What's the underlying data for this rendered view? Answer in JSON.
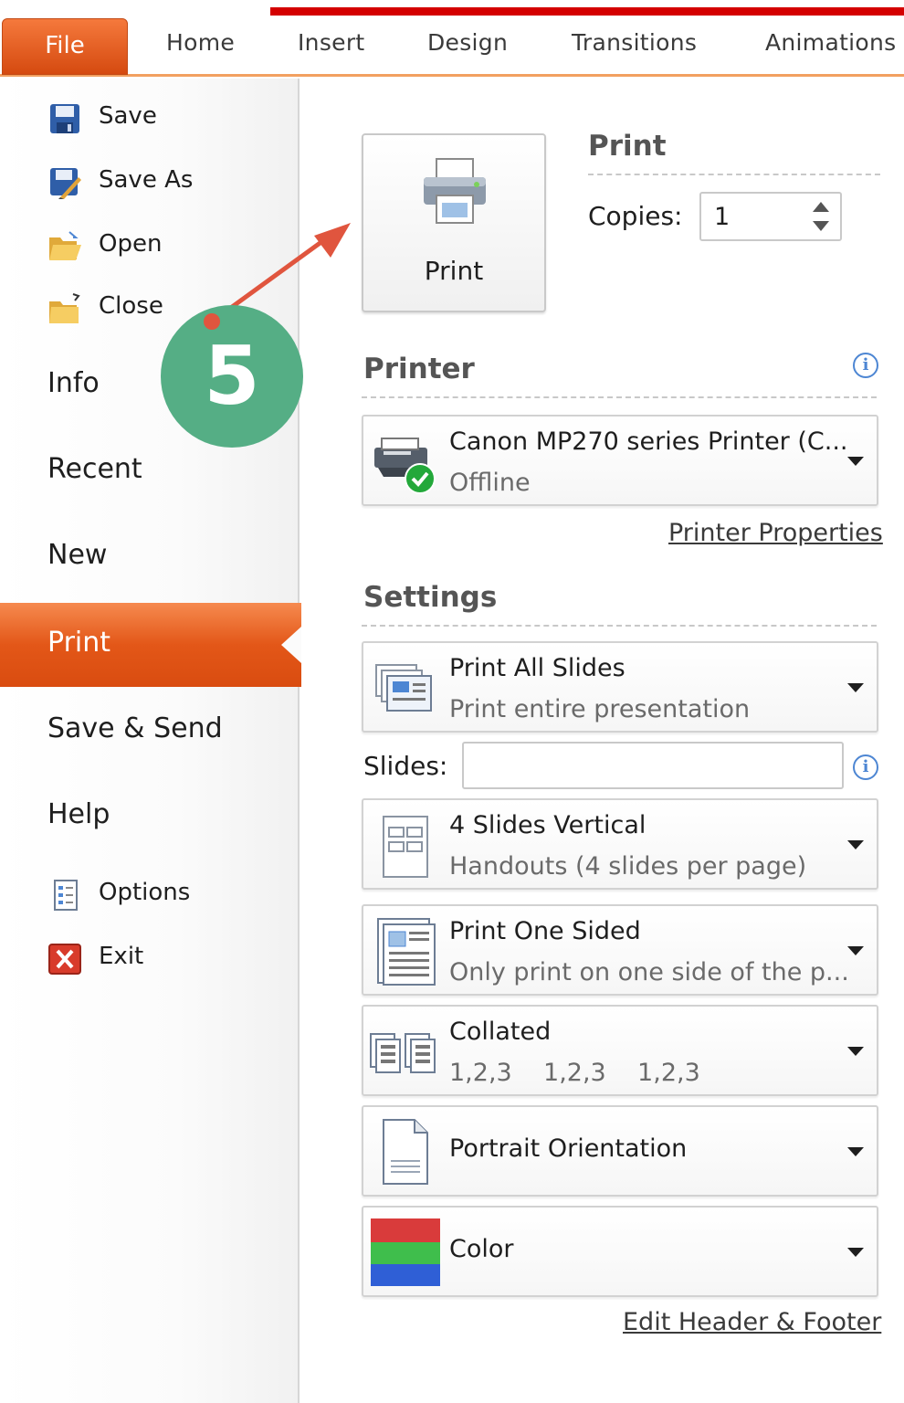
{
  "ribbon": {
    "tabs": [
      "File",
      "Home",
      "Insert",
      "Design",
      "Transitions",
      "Animations"
    ]
  },
  "sidebar": {
    "save": "Save",
    "save_as": "Save As",
    "open": "Open",
    "close": "Close",
    "info": "Info",
    "recent": "Recent",
    "new": "New",
    "print": "Print",
    "save_send": "Save & Send",
    "help": "Help",
    "options": "Options",
    "exit": "Exit"
  },
  "callout": {
    "step": "5",
    "color": "#55ae85",
    "arrow_color": "#e0553e"
  },
  "print_panel": {
    "button_label": "Print",
    "section_title": "Print",
    "copies_label": "Copies:",
    "copies_value": "1"
  },
  "printer": {
    "title": "Printer",
    "name": "Canon MP270 series Printer (C...",
    "status": "Offline",
    "properties_link": "Printer Properties"
  },
  "settings": {
    "title": "Settings",
    "slides_label": "Slides:",
    "slides_value": "",
    "items": [
      {
        "title": "Print All Slides",
        "subtitle": "Print entire presentation"
      },
      {
        "title": "4 Slides Vertical",
        "subtitle": "Handouts (4 slides per page)"
      },
      {
        "title": "Print One Sided",
        "subtitle": "Only print on one side of the p..."
      },
      {
        "title": "Collated",
        "subtitle": "1,2,3    1,2,3    1,2,3"
      },
      {
        "title": "Portrait Orientation"
      },
      {
        "title": "Color"
      }
    ],
    "footer_link": "Edit Header & Footer"
  },
  "colors": {
    "accent": "#e35718",
    "ribbon_line": "#d40000"
  }
}
